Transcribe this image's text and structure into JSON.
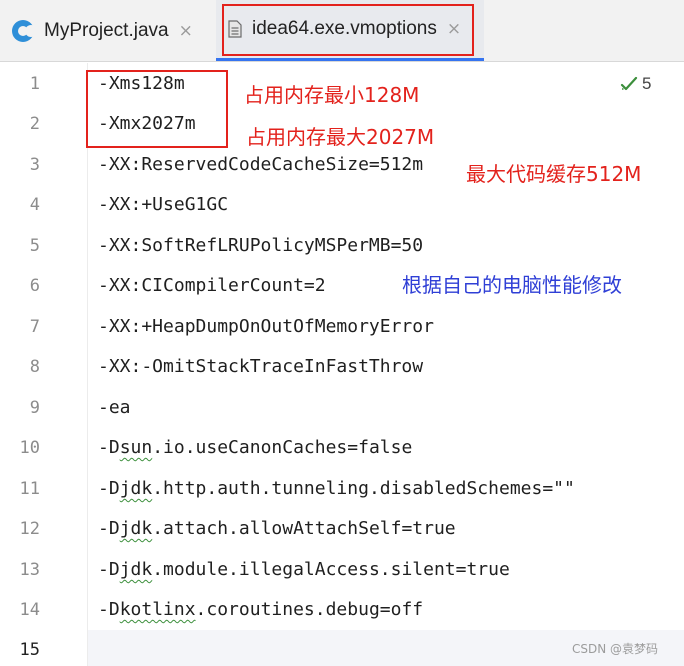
{
  "tabs": [
    {
      "label": "MyProject.java",
      "icon": "java-class-icon",
      "active": false
    },
    {
      "label": "idea64.exe.vmoptions",
      "icon": "text-file-icon",
      "active": true
    }
  ],
  "close_symbol": "×",
  "inspection": {
    "count": "5",
    "icon": "checkmark-icon",
    "color": "#3c8f3c"
  },
  "lines": [
    {
      "num": "1",
      "text": "-Xms128m"
    },
    {
      "num": "2",
      "text": "-Xmx2027m"
    },
    {
      "num": "3",
      "text": "-XX:ReservedCodeCacheSize=512m"
    },
    {
      "num": "4",
      "text": "-XX:+UseG1GC"
    },
    {
      "num": "5",
      "text": "-XX:SoftRefLRUPolicyMSPerMB=50"
    },
    {
      "num": "6",
      "text": "-XX:CICompilerCount=2"
    },
    {
      "num": "7",
      "text": "-XX:+HeapDumpOnOutOfMemoryError"
    },
    {
      "num": "8",
      "text": "-XX:-OmitStackTraceInFastThrow"
    },
    {
      "num": "9",
      "text": "-ea"
    },
    {
      "num": "10",
      "prefix": "-D",
      "squiggle": "sun",
      "rest": ".io.useCanonCaches=false"
    },
    {
      "num": "11",
      "prefix": "-D",
      "squiggle": "jdk",
      "rest": ".http.auth.tunneling.disabledSchemes=\"\""
    },
    {
      "num": "12",
      "prefix": "-D",
      "squiggle": "jdk",
      "rest": ".attach.allowAttachSelf=true"
    },
    {
      "num": "13",
      "prefix": "-D",
      "squiggle": "jdk",
      "rest": ".module.illegalAccess.silent=true"
    },
    {
      "num": "14",
      "prefix": "-D",
      "squiggle": "kotlinx",
      "rest": ".coroutines.debug=off"
    },
    {
      "num": "15",
      "text": ""
    }
  ],
  "annotations": {
    "xms": "占用内存最小128M",
    "xmx": "占用内存最大2027M",
    "codecache": "最大代码缓存512M",
    "modify": "根据自己的电脑性能修改"
  },
  "colors": {
    "annotation_red": "#e3221c",
    "annotation_blue": "#2f3fd6",
    "highlight_box": "#e3221c"
  },
  "watermark": "CSDN @袁梦码"
}
